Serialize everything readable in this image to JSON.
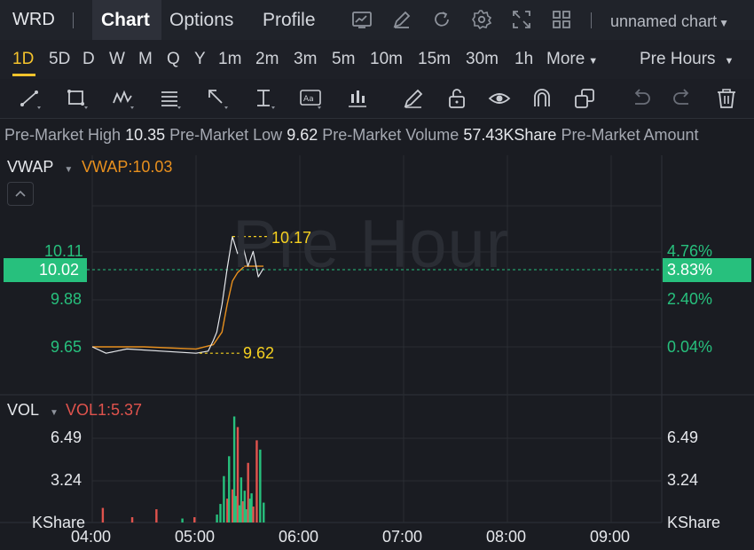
{
  "header": {
    "ticker": "WRD",
    "tabs": [
      "Chart",
      "Options",
      "Profile"
    ],
    "chart_name": "unnamed chart"
  },
  "timeframes": [
    "1D",
    "5D",
    "D",
    "W",
    "M",
    "Q",
    "Y",
    "1m",
    "2m",
    "3m",
    "5m",
    "10m",
    "15m",
    "30m",
    "1h",
    "More"
  ],
  "active_timeframe": "1D",
  "session": "Pre Hours",
  "info": {
    "high_label": "Pre-Market High",
    "high_value": "10.35",
    "low_label": "Pre-Market Low",
    "low_value": "9.62",
    "volume_label": "Pre-Market Volume",
    "volume_value": "57.43KShare",
    "amount_label": "Pre-Market Amount"
  },
  "price_panel": {
    "indicator": "VWAP",
    "indicator_value": "VWAP:10.03",
    "watermark": "Pre Hour",
    "left_labels": [
      "10.11",
      "9.88",
      "9.65"
    ],
    "right_labels": [
      "4.76%",
      "2.40%",
      "0.04%"
    ],
    "current_price": "10.02",
    "current_pct": "3.83%",
    "high_marker": "10.17",
    "low_marker": "9.62"
  },
  "volume_panel": {
    "indicator": "VOL",
    "indicator_value": "VOL1:5.37",
    "left_labels": [
      "6.49",
      "3.24",
      "KShare"
    ],
    "right_labels": [
      "6.49",
      "3.24",
      "KShare"
    ]
  },
  "x_axis": [
    "04:00",
    "05:00",
    "06:00",
    "07:00",
    "08:00",
    "09:00"
  ],
  "colors": {
    "up": "#27c07d",
    "down": "#e0534d",
    "vwap": "#e8901e",
    "accent": "#f5c32c",
    "marker": "#f5d020"
  },
  "chart_data": {
    "type": "line",
    "x_range": [
      "04:00",
      "09:00"
    ],
    "ylim": [
      9.55,
      10.38
    ],
    "series": [
      {
        "name": "Price",
        "x": [
          "04:00",
          "04:08",
          "04:20",
          "04:40",
          "05:00",
          "05:07",
          "05:10",
          "05:12",
          "05:15",
          "05:18",
          "05:21",
          "05:24",
          "05:27",
          "05:30",
          "05:33",
          "05:36",
          "05:39"
        ],
        "values": [
          9.65,
          9.62,
          9.64,
          9.63,
          9.62,
          9.63,
          9.68,
          9.72,
          9.85,
          10.02,
          10.17,
          10.09,
          10.13,
          10.03,
          10.1,
          9.98,
          10.02
        ]
      },
      {
        "name": "VWAP",
        "x": [
          "04:00",
          "04:30",
          "05:00",
          "05:10",
          "05:15",
          "05:18",
          "05:21",
          "05:24",
          "05:28",
          "05:33",
          "05:39"
        ],
        "values": [
          9.65,
          9.65,
          9.64,
          9.66,
          9.72,
          9.85,
          9.96,
          10.0,
          10.03,
          10.03,
          10.03
        ]
      }
    ],
    "volume": {
      "ylim": [
        0,
        8.5
      ],
      "bars": [
        {
          "t": "04:06",
          "v": 1.1,
          "dir": "down"
        },
        {
          "t": "04:23",
          "v": 0.4,
          "dir": "down"
        },
        {
          "t": "04:37",
          "v": 1.0,
          "dir": "down"
        },
        {
          "t": "04:52",
          "v": 0.3,
          "dir": "up"
        },
        {
          "t": "04:59",
          "v": 0.4,
          "dir": "down"
        },
        {
          "t": "05:12",
          "v": 0.6,
          "dir": "up"
        },
        {
          "t": "05:14",
          "v": 1.4,
          "dir": "up"
        },
        {
          "t": "05:16",
          "v": 3.5,
          "dir": "up"
        },
        {
          "t": "05:18",
          "v": 1.8,
          "dir": "down"
        },
        {
          "t": "05:19",
          "v": 5.0,
          "dir": "up"
        },
        {
          "t": "05:21",
          "v": 2.5,
          "dir": "down"
        },
        {
          "t": "05:22",
          "v": 8.0,
          "dir": "up"
        },
        {
          "t": "05:23",
          "v": 2.0,
          "dir": "up"
        },
        {
          "t": "05:24",
          "v": 7.2,
          "dir": "down"
        },
        {
          "t": "05:25",
          "v": 1.3,
          "dir": "up"
        },
        {
          "t": "05:26",
          "v": 3.4,
          "dir": "up"
        },
        {
          "t": "05:27",
          "v": 1.6,
          "dir": "down"
        },
        {
          "t": "05:28",
          "v": 2.4,
          "dir": "up"
        },
        {
          "t": "05:29",
          "v": 1.0,
          "dir": "up"
        },
        {
          "t": "05:30",
          "v": 4.5,
          "dir": "down"
        },
        {
          "t": "05:31",
          "v": 1.8,
          "dir": "up"
        },
        {
          "t": "05:32",
          "v": 2.2,
          "dir": "up"
        },
        {
          "t": "05:33",
          "v": 1.2,
          "dir": "down"
        },
        {
          "t": "05:35",
          "v": 6.2,
          "dir": "down"
        },
        {
          "t": "05:37",
          "v": 5.5,
          "dir": "up"
        },
        {
          "t": "05:39",
          "v": 1.5,
          "dir": "up"
        }
      ]
    }
  }
}
